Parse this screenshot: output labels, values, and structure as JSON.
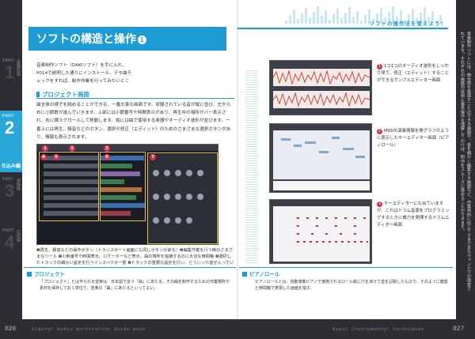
{
  "header": {
    "title": "ソフトの構造と操作",
    "title_num": "1",
    "subtitle": "ソフトの操作法を覚えよう！"
  },
  "left_tabs": [
    {
      "part": "PART",
      "num": "1",
      "jp": "基礎知識"
    },
    {
      "part": "PART",
      "num": "2",
      "jp": "仕込み編"
    },
    {
      "part": "PART",
      "num": "3",
      "jp": "実践編"
    },
    {
      "part": "PART",
      "num": "4",
      "jp": "応用編"
    }
  ],
  "active_label": "仕込み編",
  "intro": "音楽制作ソフト（DAWソフト）を手に入れ、P014で説明した通りにインストール、デモ曲チェックをすれば、制作作業を行ってみたいところです。しかし、まずはしっかりと「構造」と「操作法」について覚えておきましょう。",
  "section": {
    "heading": "プロジェクト画面",
    "text": "曲全体の様子を眺めることができる、一番大事な画面です。収録されている音が縦に並び、左から右に小節数が進んでいきます。上部には小節番号や時間表示があり、再生中の場所がバー表示され、右に横スクロールして移動します。縦には曲で使用する楽器やオーディオ波形が並びます。一番上には再生、録音などのボタン、選択や修正（エディット）のためのさまざまな選択ボタンがあり、情報も表示されます。"
  },
  "notes": "❶再生、録音などの操作ボタン（トランスポート画面にも同じボタンがある）❷編集作業を行う時のさまざまなツール ❸小節番号や時間表示。ロケーターなど表示、曲の場所を指摘するのに大切な時間軸 ❹選択したトラックの細かい設定を行うインスペクター部 ❺トラックの重要な設定を行い、どういった音が入っているかを縦のリストにしたトラックリスト ❻波形（イベント）がどのトラックにどのように入っているか、小節数に沿ったイベントを表して移動や消去、コピーなどもできる ❼付属のソフトウェア音源の使用しているパラメーターを簡単にエディットしたり、サンプリングサウンドなどを表示",
  "captions": [
    {
      "num": "1",
      "text": "1つ1つのオーディオ波形をしっかり見て、修正（エディット）することができるサンプルエディター画面"
    },
    {
      "num": "2",
      "text": "MIDIの演奏情報を棒グラフのように表示したキーエディター画面（ピアノロール）"
    },
    {
      "num": "3",
      "text": "キーエディターにも似ていますが、これはドラム音源をプログラミングするときに威力を発揮するドラムエディター画面"
    }
  ],
  "footer_boxes": [
    {
      "heading": "プロジェクト",
      "text": "「プロジェクト」とは作られる音楽は、日本語で言う「曲」にあたる。その曲を制作するための作業場所や素材を保存しておく単位で、音楽の「曲」にあたるといってよい。"
    },
    {
      "heading": "ピアノロール",
      "text": "ピアノロールとは、自動演奏ピアノで使用されるロール紙に穴をあけて音を記録したもので、そのように鍵盤と時間軸で表現した画面を指す。"
    }
  ],
  "right_text": "音楽制作ソフトには、曲全体を見渡すことのできる画面や、音を細かく編集する画面など、作業目的に応じてさまざまなウィンドウが用意されています。それぞれの画面の役割と基本操作を理解しておけば、制作をスムーズに進めることができます。",
  "footer": {
    "left_page": "026",
    "right_page": "027",
    "left_text": "Digital Audio Workstation Guide Book",
    "right_text": "Basic instrumental techniques"
  }
}
